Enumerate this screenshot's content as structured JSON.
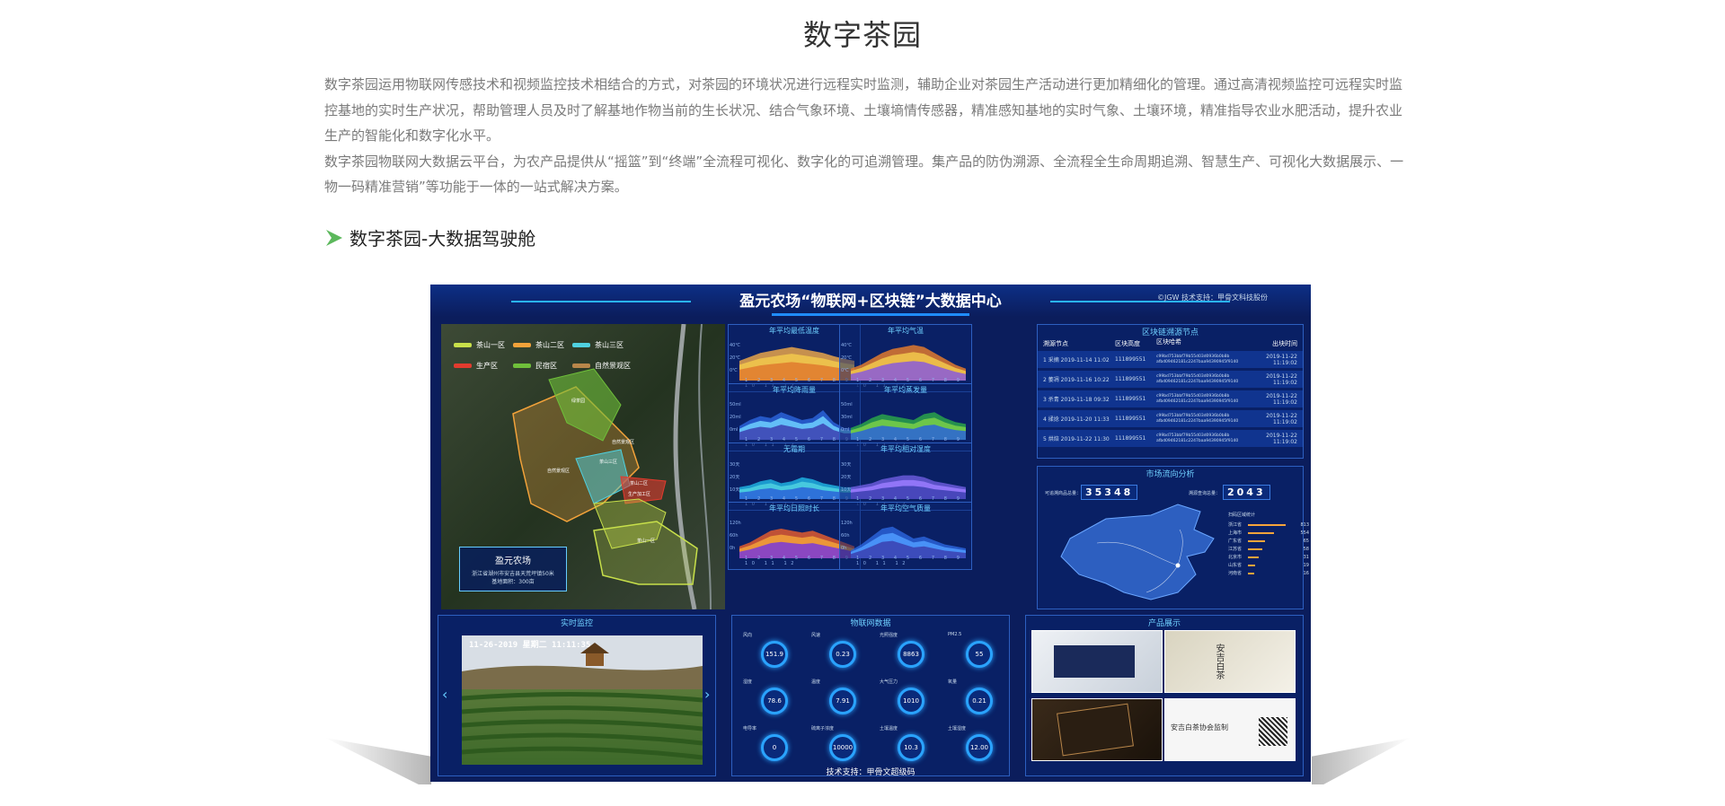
{
  "page": {
    "title": "数字茶园",
    "intro_paragraphs": [
      "数字茶园运用物联网传感技术和视频监控技术相结合的方式，对茶园的环境状况进行远程实时监测，辅助企业对茶园生产活动进行更加精细化的管理。通过高清视频监控可远程实时监控基地的实时生产状况，帮助管理人员及时了解基地作物当前的生长状况、结合气象环境、土壤墒情传感器，精准感知基地的实时气象、土壤环境，精准指导农业水肥活动，提升农业生产的智能化和数字化水平。",
      "数字茶园物联网大数据云平台，为农产品提供从“摇篮”到“终端”全流程可视化、数字化的可追溯管理。集产品的防伪溯源、全流程全生命周期追溯、智慧生产、可视化大数据展示、一物一码精准营销”等功能于一体的一站式解决方案。"
    ],
    "section_title": "数字茶园-大数据驾驶舱"
  },
  "dashboard": {
    "title": "盈元农场“物联网+区块链”大数据中心",
    "credit": "©JGW  技术支持：甲骨文科技股份",
    "footer": "技术支持：甲骨文超级码",
    "map": {
      "legend": [
        {
          "label": "茶山一区",
          "color": "#c8e04a"
        },
        {
          "label": "茶山二区",
          "color": "#f2a23a"
        },
        {
          "label": "茶山三区",
          "color": "#4fd1e0"
        },
        {
          "label": "生产区",
          "color": "#e23b2e"
        },
        {
          "label": "民宿区",
          "color": "#6fbf3a"
        },
        {
          "label": "自然景观区",
          "color": "#b8864a"
        }
      ],
      "zones": [
        "绿茶园",
        "自然景观区",
        "茶山三区",
        "茶山二区",
        "生产加工区",
        "茶山一区",
        "自然景观区"
      ],
      "farm_name": "盈元农场",
      "farm_desc1": "浙江省湖州市安吉县天荒坪镇50米",
      "farm_desc2": "基地面积：300亩"
    },
    "charts": [
      {
        "title": "年平均最低温度",
        "yticks": [
          "40℃",
          "20℃",
          "0℃"
        ]
      },
      {
        "title": "年平均气温",
        "yticks": [
          "40℃",
          "20℃",
          "0℃"
        ]
      },
      {
        "title": "年平均降雨量",
        "yticks": [
          "50ml",
          "20ml",
          "0ml"
        ]
      },
      {
        "title": "年平均蒸发量",
        "yticks": [
          "50ml",
          "30ml",
          "0ml"
        ]
      },
      {
        "title": "无霜期",
        "yticks": [
          "30天",
          "20天",
          "10天"
        ]
      },
      {
        "title": "年平均相对湿度",
        "yticks": [
          "30天",
          "20天",
          "10天"
        ]
      },
      {
        "title": "年平均日照时长",
        "yticks": [
          "120h",
          "60h",
          "0h"
        ]
      },
      {
        "title": "年平均空气质量",
        "yticks": [
          "120h",
          "60h",
          "0h"
        ]
      }
    ],
    "month_axis": "1 2 3 4 5 6 7 8 9 10 11 12",
    "blockchain": {
      "title": "区块链溯源节点",
      "headers": [
        "溯源节点",
        "区块高度",
        "区块哈希",
        "出块时间"
      ],
      "rows": [
        {
          "idx": "1",
          "node": "采摘",
          "date": "2019-11-14 11:02",
          "height": "111899551",
          "hash": "c99bd753bbf79b55d03d0936b0b8b afbd09462181c2247baa94390945f9140",
          "time": "2019-11-22 11:19:02"
        },
        {
          "idx": "2",
          "node": "萎凋",
          "date": "2019-11-16 10:22",
          "height": "111899551",
          "hash": "c99bd753bbf79b55d03d0936b0b8b afbd09462181c2247baa94390945f9140",
          "time": "2019-11-22 11:19:02"
        },
        {
          "idx": "3",
          "node": "杀青",
          "date": "2019-11-18 09:32",
          "height": "111899551",
          "hash": "c99bd753bbf79b55d03d0936b0b8b afbd09462181c2247baa94390945f9140",
          "time": "2019-11-22 11:19:02"
        },
        {
          "idx": "4",
          "node": "揉捻",
          "date": "2019-11-20 11:33",
          "height": "111899551",
          "hash": "c99bd753bbf79b55d03d0936b0b8b afbd09462181c2247baa94390945f9140",
          "time": "2019-11-22 11:19:02"
        },
        {
          "idx": "5",
          "node": "烘焙",
          "date": "2019-11-22 11:30",
          "height": "111899551",
          "hash": "c99bd753bbf79b55d03d0936b0b8b afbd09462181c2247baa94390945f9140",
          "time": "2019-11-22 11:19:02"
        }
      ]
    },
    "market": {
      "title": "市场流向分析",
      "label_left": "可追溯商品总量：",
      "value_left": "35348",
      "label_right": "溯源查询总量：",
      "value_right": "2043",
      "region_title": "扫码区域统计",
      "regions": [
        {
          "name": "浙江省",
          "value": "813",
          "frac": 1.0
        },
        {
          "name": "上海市",
          "value": "554",
          "frac": 0.68
        },
        {
          "name": "广东省",
          "value": "65",
          "frac": 0.45
        },
        {
          "name": "江苏省",
          "value": "58",
          "frac": 0.38
        },
        {
          "name": "北京市",
          "value": "31",
          "frac": 0.28
        },
        {
          "name": "山东省",
          "value": "19",
          "frac": 0.2
        },
        {
          "name": "河南省",
          "value": "16",
          "frac": 0.16
        }
      ]
    },
    "monitor": {
      "title": "实时监控",
      "timestamp": "11-26-2019  星期二  11:11:35"
    },
    "iot": {
      "title": "物联网数据",
      "gauges": [
        {
          "label": "风向",
          "value": "151.9"
        },
        {
          "label": "风速",
          "value": "0.23"
        },
        {
          "label": "光照强度",
          "value": "8863"
        },
        {
          "label": "PM2.5",
          "value": "55"
        },
        {
          "label": "湿度",
          "value": "78.6"
        },
        {
          "label": "温度",
          "value": "7.91"
        },
        {
          "label": "大气压力",
          "value": "1010"
        },
        {
          "label": "氧量",
          "value": "0.21"
        },
        {
          "label": "电导率",
          "value": "0"
        },
        {
          "label": "硫离子浓度",
          "value": "10000"
        },
        {
          "label": "土壤温度",
          "value": "10.3"
        },
        {
          "label": "土壤湿度",
          "value": "12.00"
        }
      ]
    },
    "products": {
      "title": "产品展示",
      "cert_text": "安吉白茶协会监制",
      "box_text": "安吉白茶"
    }
  },
  "colors": {
    "dash_bg": "#0b1d5c",
    "accent": "#2ab4ff",
    "section_arrow": "#5cb85c"
  }
}
